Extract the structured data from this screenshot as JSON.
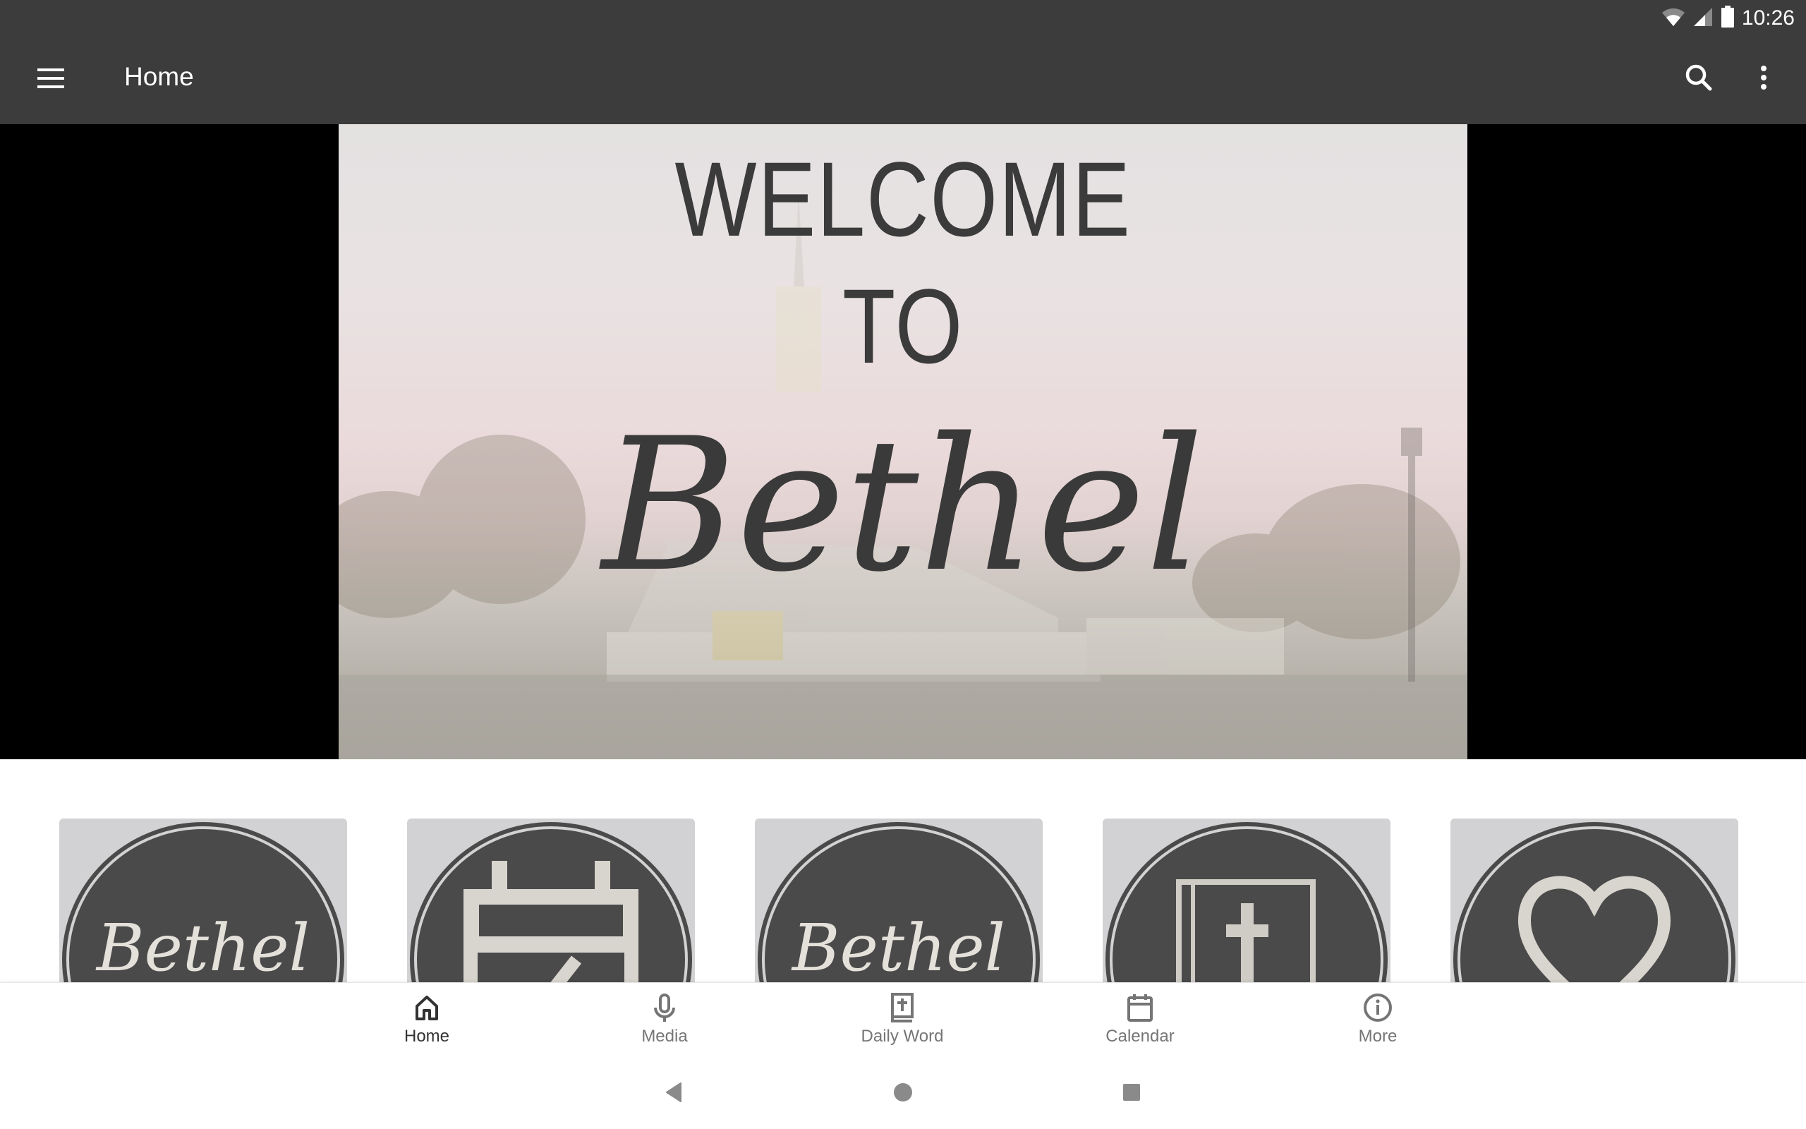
{
  "status_bar": {
    "time": "10:26",
    "icons": [
      "wifi-icon",
      "cellular-signal-icon",
      "battery-icon"
    ]
  },
  "app_bar": {
    "title": "Home",
    "menu_icon": "hamburger-menu-icon",
    "actions": [
      "search-icon",
      "more-vert-icon"
    ]
  },
  "banner": {
    "line1": "WELCOME",
    "line2": "TO",
    "line3": "Bethel"
  },
  "tiles": [
    {
      "name": "bethel-logo-tile",
      "icon": "bethel-script-logo",
      "text": "Bethel"
    },
    {
      "name": "calendar-tile",
      "icon": "calendar-check-icon"
    },
    {
      "name": "bethel-logo-tile-2",
      "icon": "bethel-script-logo",
      "text": "Bethel"
    },
    {
      "name": "bible-tile",
      "icon": "bible-cross-icon"
    },
    {
      "name": "heart-tile",
      "icon": "heart-icon"
    }
  ],
  "bottom_nav": {
    "items": [
      {
        "label": "Home",
        "icon": "home-icon",
        "active": true
      },
      {
        "label": "Media",
        "icon": "microphone-icon",
        "active": false
      },
      {
        "label": "Daily Word",
        "icon": "bible-icon",
        "active": false
      },
      {
        "label": "Calendar",
        "icon": "calendar-icon",
        "active": false
      },
      {
        "label": "More",
        "icon": "info-icon",
        "active": false
      }
    ]
  },
  "system_nav": [
    "back-icon",
    "home-circle-icon",
    "recents-icon"
  ],
  "colors": {
    "app_bar": "#3c3c3c",
    "tile_bg": "#d2d2d4",
    "badge_dark": "#4a4a4a",
    "badge_light": "#d8d4ce",
    "nav_active": "#333333",
    "nav_inactive": "#757575"
  }
}
